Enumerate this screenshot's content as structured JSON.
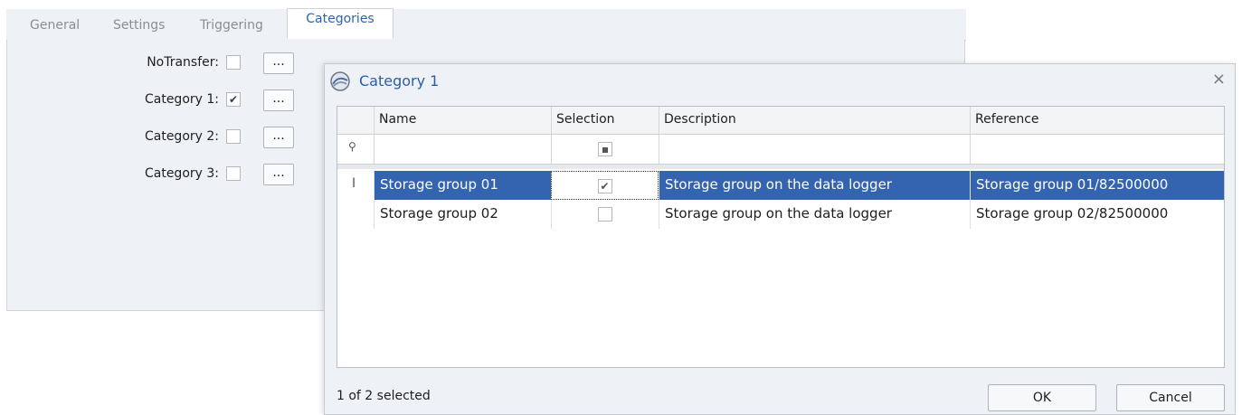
{
  "tabs": [
    "General",
    "Settings",
    "Triggering",
    "Categories"
  ],
  "categories": [
    {
      "label": "NoTransfer:",
      "checked": false
    },
    {
      "label": "Category 1:",
      "checked": true
    },
    {
      "label": "Category 2:",
      "checked": false
    },
    {
      "label": "Category 3:",
      "checked": false
    }
  ],
  "ellipsis_label": "...",
  "dialog": {
    "title": "Category 1",
    "close_glyph": "×",
    "columns": [
      "Name",
      "Selection",
      "Description",
      "Reference"
    ],
    "rows": [
      {
        "name": "Storage group 01",
        "selected": true,
        "description": "Storage group on the data logger",
        "reference": "Storage group 01/82500000"
      },
      {
        "name": "Storage group 02",
        "selected": false,
        "description": "Storage group on the data logger",
        "reference": "Storage group 02/82500000"
      }
    ],
    "status": "1 of 2 selected",
    "ok_label": "OK",
    "cancel_label": "Cancel"
  },
  "colors": {
    "accent": "#2a65b0",
    "selection": "#3463b0"
  }
}
